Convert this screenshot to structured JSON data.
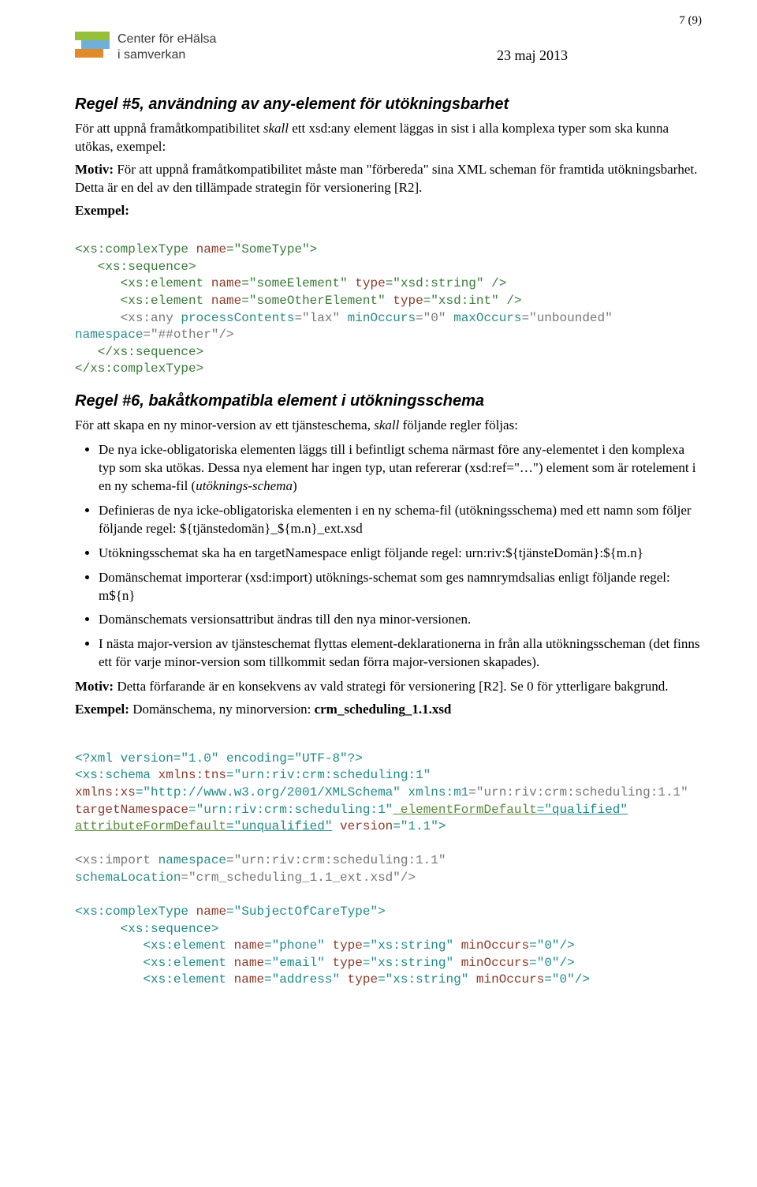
{
  "pagenum": "7 (9)",
  "logo": {
    "l1": "Center för eHälsa",
    "l2": "i samverkan"
  },
  "date": "23 maj 2013",
  "h5_title": "Regel #5, användning av any-element för utökningsbarhet",
  "h5_p1a": "För att uppnå framåtkompatibilitet ",
  "h5_p1_skall": "skall",
  "h5_p1b": " ett xsd:any element läggas in sist i alla komplexa typer som ska kunna utökas, exempel:",
  "h5_motiv_label": "Motiv:",
  "h5_motiv_text": " För att uppnå framåtkompatibilitet måste man \"förbereda\" sina XML scheman för framtida utökningsbarhet. Detta är en del av den tillämpade strategin för versionering [R2].",
  "h5_exempel_label": "Exempel:",
  "code5": {
    "l1a": "<xs:complexType",
    "l1b": " name",
    "l1c": "=\"SomeType\"",
    "l1d": ">",
    "l2a": "   <xs:sequence>",
    "l3a": "      <xs:element",
    "l3b": " name",
    "l3c": "=\"someElement\"",
    "l3d": " type",
    "l3e": "=\"xsd:string\"",
    "l3f": " />",
    "l4a": "      <xs:element",
    "l4b": " name",
    "l4c": "=\"someOtherElement\"",
    "l4d": " type",
    "l4e": "=\"xsd:int\"",
    "l4f": " />",
    "l5a": "      <xs:any",
    "l5b": " processContents",
    "l5c": "=\"lax\"",
    "l5d": " minOccurs",
    "l5e": "=\"0\"",
    "l5f": " maxOccurs",
    "l5g": "=\"unbounded\"",
    "l6a": "namespace",
    "l6b": "=\"##other\"",
    "l6c": "/>",
    "l7": "   </xs:sequence>",
    "l8": "</xs:complexType>"
  },
  "h6_title": "Regel #6, bakåtkompatibla element i utökningsschema",
  "h6_p1a": "För att skapa en ny minor-version av ett tjänsteschema, ",
  "h6_p1_skall": "skall",
  "h6_p1b": " följande regler följas:",
  "h6_li1a": "De nya icke-obligatoriska elementen läggs till i befintligt schema närmast före any-elementet i den komplexa typ som ska utökas. Dessa nya element har ingen typ, utan refererar (xsd:ref=\"…\") element som är rotelement i en ny schema-fil (",
  "h6_li1_em": "utöknings-schema",
  "h6_li1b": ")",
  "h6_li2": "Definieras de nya icke-obligatoriska elementen i en ny schema-fil (utökningsschema) med ett namn som följer följande regel: ${tjänstedomän}_${m.n}_ext.xsd",
  "h6_li3": "Utökningsschemat ska ha en targetNamespace enligt följande regel: urn:riv:${tjänsteDomän}:${m.n}",
  "h6_li4": "Domänschemat importerar (xsd:import) utöknings-schemat som ges namnrymdsalias enligt följande regel: m${n}",
  "h6_li5": "Domänschemats versionsattribut ändras till den nya minor-versionen.",
  "h6_li6": "I nästa major-version av tjänsteschemat flyttas element-deklarationerna in från alla utökningsscheman (det finns ett för varje minor-version som tillkommit sedan förra major-versionen skapades).",
  "h6_motiv_label": "Motiv:",
  "h6_motiv_text": " Detta förfarande är en konsekvens av vald strategi för versionering [R2]. Se 0 för ytterligare bakgrund.",
  "h6_exempel_label": "Exempel:",
  "h6_exempel_text": " Domänschema, ny minorversion: ",
  "h6_exempel_file": "crm_scheduling_1.1.xsd",
  "code6": {
    "l1": "<?xml version=\"1.0\" encoding=\"UTF-8\"?>",
    "l2a": "<xs:schema",
    "l2b": " xmlns:tns",
    "l2c": "=\"urn:riv:crm:scheduling:1\"",
    "l3a": "xmlns:xs",
    "l3b": "=\"http://www.w3.org/2001/XMLSchema\"",
    "l3c": " xmlns:m1",
    "l3d": "=\"urn:riv:crm:scheduling:1.1\"",
    "l4a": "targetNamespace",
    "l4b": "=\"urn:riv:crm:scheduling:1\"",
    "l4c": " elementFormDefault",
    "l4d": "=\"qualified\"",
    "l5a": "attributeFormDefault",
    "l5b": "=\"unqualified\"",
    "l5c": " version",
    "l5d": "=\"1.1\"",
    "l5e": ">",
    "l7a": "<xs:import",
    "l7b": " namespace",
    "l7c": "=\"urn:riv:crm:scheduling:1.1\"",
    "l8a": "schemaLocation",
    "l8b": "=\"crm_scheduling_1.1_ext.xsd\"",
    "l8c": "/>",
    "l10a": "<xs:complexType",
    "l10b": " name",
    "l10c": "=\"SubjectOfCareType\"",
    "l10d": ">",
    "l11": "      <xs:sequence>",
    "l12a": "         <xs:element",
    "l12b": " name",
    "l12c": "=\"phone\"",
    "l12d": " type",
    "l12e": "=\"xs:string\"",
    "l12f": " minOccurs",
    "l12g": "=\"0\"",
    "l12h": "/>",
    "l13a": "         <xs:element",
    "l13b": " name",
    "l13c": "=\"email\"",
    "l13d": " type",
    "l13e": "=\"xs:string\"",
    "l13f": " minOccurs",
    "l13g": "=\"0\"",
    "l13h": "/>",
    "l14a": "         <xs:element",
    "l14b": " name",
    "l14c": "=\"address\"",
    "l14d": " type",
    "l14e": "=\"xs:string\"",
    "l14f": " minOccurs",
    "l14g": "=\"0\"",
    "l14h": "/>"
  }
}
